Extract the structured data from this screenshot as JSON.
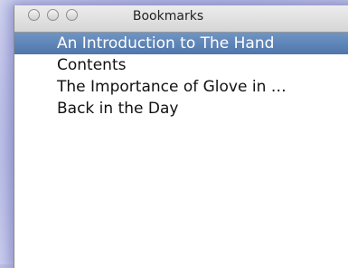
{
  "window": {
    "title": "Bookmarks"
  },
  "bookmarks": {
    "items": [
      {
        "label": "An Introduction to The Hand",
        "selected": true
      },
      {
        "label": "Contents",
        "selected": false
      },
      {
        "label": "The Importance of Glove in …",
        "selected": false
      },
      {
        "label": "Back in the Day",
        "selected": false
      }
    ]
  },
  "colors": {
    "selection": "#5b82b6",
    "background_glow": "#a8aee0"
  }
}
